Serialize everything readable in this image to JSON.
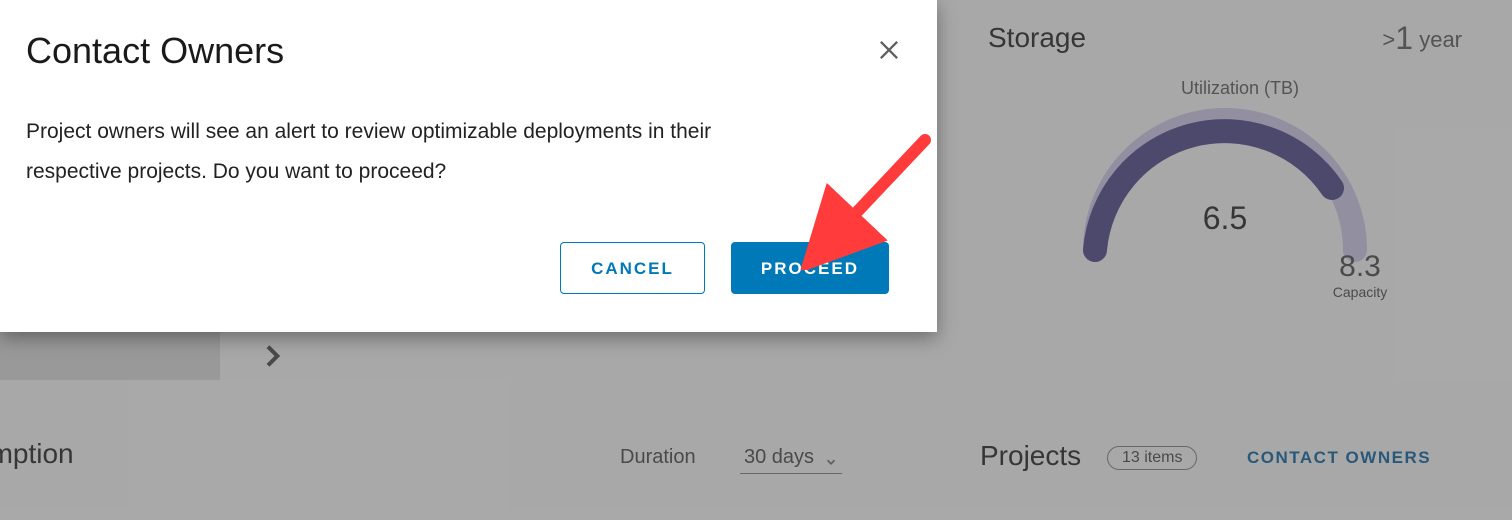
{
  "modal": {
    "title": "Contact Owners",
    "body": "Project owners will see an alert to review optimizable deployments in their respective projects. Do you want to proceed?",
    "cancel_label": "CANCEL",
    "proceed_label": "PROCEED"
  },
  "storage": {
    "title": "Storage",
    "range_prefix": ">",
    "range_value": "1",
    "range_unit": "year",
    "gauge_title": "Utilization (TB)",
    "used_value": "6.5",
    "capacity_value": "8.3",
    "capacity_label": "Capacity"
  },
  "bottom": {
    "consumption_title": "sumption",
    "duration_label": "Duration",
    "duration_value": "30 days",
    "projects_title": "Projects",
    "items_pill": "13 items",
    "contact_owners_link": "CONTACT OWNERS"
  },
  "chart_data": {
    "type": "gauge",
    "title": "Utilization (TB)",
    "value": 6.5,
    "max": 8.3,
    "unit": "TB"
  }
}
